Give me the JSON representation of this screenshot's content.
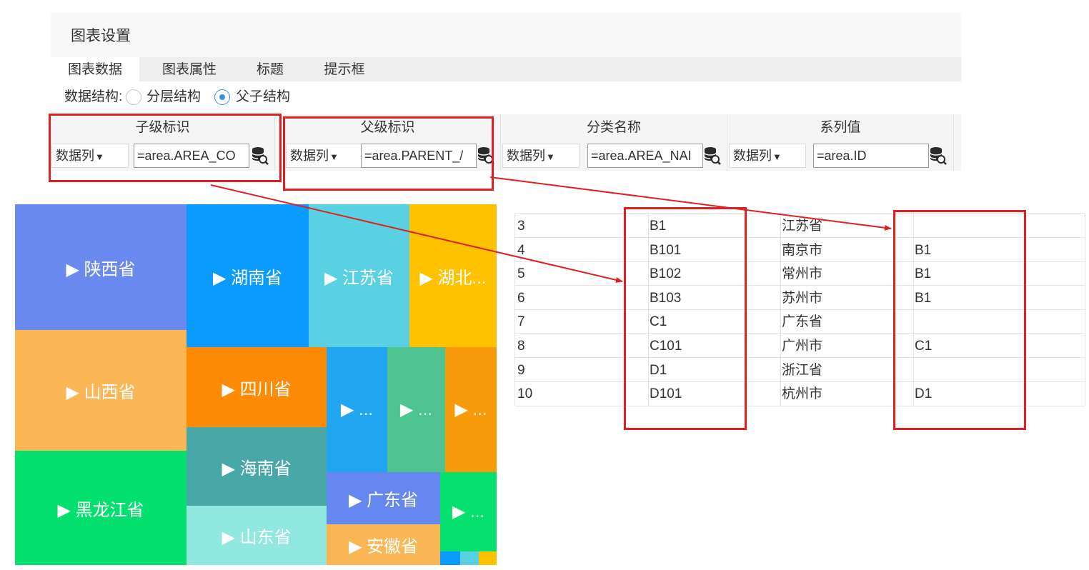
{
  "settings": {
    "title": "图表设置",
    "tabs": [
      {
        "label": "图表数据"
      },
      {
        "label": "图表属性"
      },
      {
        "label": "标题"
      },
      {
        "label": "提示框"
      }
    ],
    "structure": {
      "label": "数据结构:",
      "options": [
        {
          "label": "分层结构",
          "selected": false
        },
        {
          "label": "父子结构",
          "selected": true
        }
      ]
    },
    "columns": [
      {
        "header": "子级标识",
        "type": "数据列",
        "formula": "=area.AREA_CO"
      },
      {
        "header": "父级标识",
        "type": "数据列",
        "formula": "=area.PARENT_/"
      },
      {
        "header": "分类名称",
        "type": "数据列",
        "formula": "=area.AREA_NAI"
      },
      {
        "header": "系列值",
        "type": "数据列",
        "formula": "=area.ID"
      }
    ]
  },
  "colors": {
    "highlight": "#e02020",
    "accent": "#3a8ee6"
  },
  "treemap": {
    "tiles": [
      {
        "label": "▶ 陕西省",
        "color": "#6b8af0"
      },
      {
        "label": "▶ 湖南省",
        "color": "#0b9bff"
      },
      {
        "label": "▶ 江苏省",
        "color": "#59d1e3"
      },
      {
        "label": "▶ 湖北...",
        "color": "#fec200"
      },
      {
        "label": "▶ 山西省",
        "color": "#fbb656"
      },
      {
        "label": "▶ 四川省",
        "color": "#ff8a05"
      },
      {
        "label": "▶ ...",
        "color": "#22a5f0"
      },
      {
        "label": "▶ ...",
        "color": "#4ec590"
      },
      {
        "label": "▶ ...",
        "color": "#f79b0b"
      },
      {
        "label": "▶ 海南省",
        "color": "#48a8a7"
      },
      {
        "label": "▶ 黑龙江省",
        "color": "#03e06e"
      },
      {
        "label": "▶ 广东省",
        "color": "#6686f0"
      },
      {
        "label": "▶ ...",
        "color": "#05e06f"
      },
      {
        "label": "▶ 山东省",
        "color": "#91e8e1"
      },
      {
        "label": "▶ 安徽省",
        "color": "#fbb755"
      },
      {
        "label": "",
        "color": "#0b9bff"
      },
      {
        "label": "",
        "color": "#59d1e3"
      },
      {
        "label": "",
        "color": "#fec200"
      }
    ]
  },
  "table": {
    "rows": [
      [
        "3",
        "B1",
        "江苏省",
        ""
      ],
      [
        "4",
        "B101",
        "南京市",
        "B1"
      ],
      [
        "5",
        "B102",
        "常州市",
        "B1"
      ],
      [
        "6",
        "B103",
        "苏州市",
        "B1"
      ],
      [
        "7",
        "C1",
        "广东省",
        ""
      ],
      [
        "8",
        "C101",
        "广州市",
        "C1"
      ],
      [
        "9",
        "D1",
        "浙江省",
        ""
      ],
      [
        "10",
        "D101",
        "杭州市",
        "D1"
      ]
    ]
  }
}
